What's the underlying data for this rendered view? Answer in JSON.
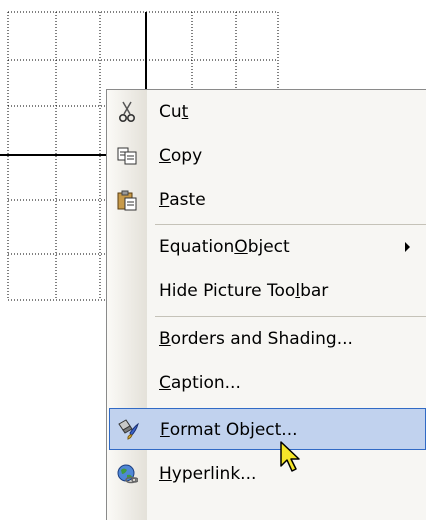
{
  "menu": {
    "items": [
      {
        "name": "cut",
        "icon": "scissors-icon",
        "pre": "Cu",
        "key": "t",
        "post": ""
      },
      {
        "name": "copy",
        "icon": "copy-icon",
        "pre": "",
        "key": "C",
        "post": "opy"
      },
      {
        "name": "paste",
        "icon": "paste-icon",
        "pre": "",
        "key": "P",
        "post": "aste"
      },
      {
        "name": "equation-object",
        "icon": "",
        "pre": "Equation ",
        "key": "O",
        "post": "bject",
        "submenu": true
      },
      {
        "name": "hide-picture-toolbar",
        "icon": "",
        "pre": "Hide Picture Too",
        "key": "l",
        "post": "bar"
      },
      {
        "name": "borders-and-shading",
        "icon": "",
        "pre": "",
        "key": "B",
        "post": "orders and Shading..."
      },
      {
        "name": "caption",
        "icon": "",
        "pre": "",
        "key": "C",
        "post": "aption..."
      },
      {
        "name": "format-object",
        "icon": "format-object-icon",
        "pre": "",
        "key": "F",
        "post": "ormat Object...",
        "highlighted": true
      },
      {
        "name": "hyperlink",
        "icon": "hyperlink-icon",
        "pre": "",
        "key": "H",
        "post": "yperlink..."
      }
    ]
  },
  "colors": {
    "menu_bg": "#f7f6f3",
    "highlight_bg": "#c1d2ee",
    "highlight_border": "#316ac5"
  }
}
